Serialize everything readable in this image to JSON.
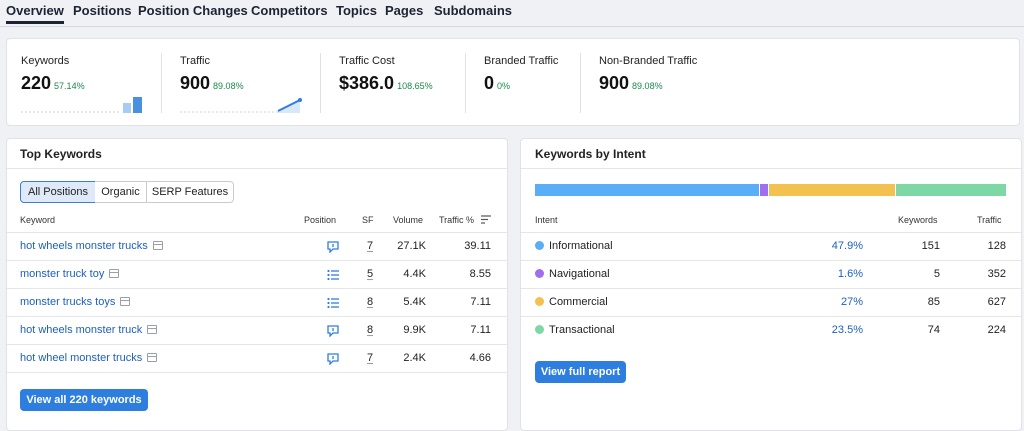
{
  "tabs": [
    "Overview",
    "Positions",
    "Position Changes",
    "Competitors",
    "Topics",
    "Pages",
    "Subdomains"
  ],
  "summary": {
    "keywords": {
      "label": "Keywords",
      "value": "220",
      "pct": "57.14%"
    },
    "traffic": {
      "label": "Traffic",
      "value": "900",
      "pct": "89.08%"
    },
    "traffic_cost": {
      "label": "Traffic Cost",
      "value": "$386.0",
      "pct": "108.65%"
    },
    "branded": {
      "label": "Branded Traffic",
      "value": "0",
      "pct": "0%"
    },
    "non_branded": {
      "label": "Non-Branded Traffic",
      "value": "900",
      "pct": "89.08%"
    }
  },
  "top_keywords": {
    "title": "Top Keywords",
    "filters": [
      "All Positions",
      "Organic",
      "SERP Features"
    ],
    "columns": {
      "keyword": "Keyword",
      "position": "Position",
      "sf": "SF",
      "volume": "Volume",
      "traffic": "Traffic %"
    },
    "rows": [
      {
        "keyword": "hot wheels monster trucks",
        "position_icon": "chat-icon",
        "sf": "7",
        "volume": "27.1K",
        "traffic": "39.11"
      },
      {
        "keyword": "monster truck toy",
        "position_icon": "list-icon",
        "sf": "5",
        "volume": "4.4K",
        "traffic": "8.55"
      },
      {
        "keyword": "monster trucks toys",
        "position_icon": "list-icon",
        "sf": "8",
        "volume": "5.4K",
        "traffic": "7.11"
      },
      {
        "keyword": "hot wheels monster truck",
        "position_icon": "chat-icon",
        "sf": "8",
        "volume": "9.9K",
        "traffic": "7.11"
      },
      {
        "keyword": "hot wheel monster trucks",
        "position_icon": "chat-icon",
        "sf": "7",
        "volume": "2.4K",
        "traffic": "4.66"
      }
    ],
    "view_all": "View all 220 keywords"
  },
  "intent": {
    "title": "Keywords by Intent",
    "columns": {
      "intent": "Intent",
      "keywords": "Keywords",
      "traffic": "Traffic"
    },
    "rows": [
      {
        "name": "Informational",
        "pct": "47.9%",
        "share": 47.9,
        "keywords": "151",
        "traffic": "128",
        "color": "#59aef7"
      },
      {
        "name": "Navigational",
        "pct": "1.6%",
        "share": 1.6,
        "keywords": "5",
        "traffic": "352",
        "color": "#a26ef0"
      },
      {
        "name": "Commercial",
        "pct": "27%",
        "share": 27,
        "keywords": "85",
        "traffic": "627",
        "color": "#f3c14f"
      },
      {
        "name": "Transactional",
        "pct": "23.5%",
        "share": 23.5,
        "keywords": "74",
        "traffic": "224",
        "color": "#7ed8a5"
      }
    ],
    "view_full": "View full report"
  }
}
